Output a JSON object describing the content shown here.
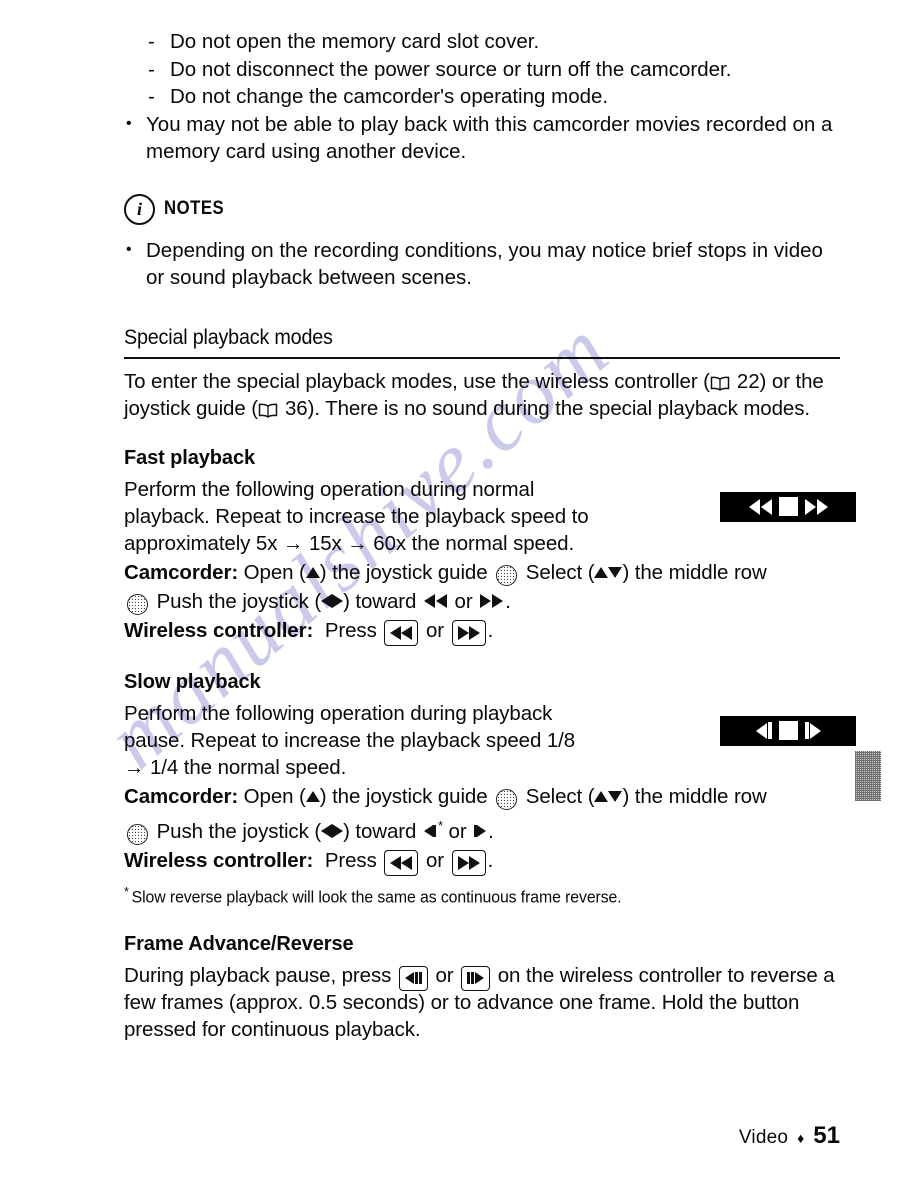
{
  "page": {
    "footer_label": "Video",
    "footer_separator": "♦",
    "footer_page_number": "51",
    "watermark": "manualshive.com"
  },
  "warnings": {
    "dash_items": [
      "Do not open the memory card slot cover.",
      "Do not disconnect the power source or turn off the camcorder.",
      "Do not change the camcorder's operating mode."
    ],
    "dash_marker": "-",
    "bullet_marker": "•",
    "bullet_items": [
      "You may not be able to play back with this camcorder movies recorded on a memory card using another device."
    ]
  },
  "notes": {
    "icon": "info-circle-icon",
    "icon_glyph": "i",
    "label": "NOTES",
    "bullet_marker": "•",
    "items": [
      "Depending on the recording conditions, you may notice brief stops in video or sound playback between scenes."
    ]
  },
  "section": {
    "title": "Special playback modes",
    "intro_part1": "To enter the special playback modes, use the wireless controller (",
    "intro_ref1_page": "22",
    "intro_part2": ") or the joystick guide (",
    "intro_ref2_page": "36",
    "intro_part3": "). There is no sound during the special playback modes."
  },
  "fast_playback": {
    "heading": "Fast playback",
    "description": "Perform the following operation during normal playback. Repeat to increase the playback speed to approximately 5x → 15x → 60x the normal speed.",
    "device_shot": {
      "name": "fast-playback-screen",
      "icons": [
        "rewind-double-icon",
        "stop-square-icon",
        "fast-forward-double-icon"
      ]
    },
    "camcorder_label": "Camcorder:",
    "camcorder_t1": "Open (",
    "camcorder_t2": ") the joystick guide",
    "camcorder_t3": "Select (",
    "camcorder_t4": ") the middle row",
    "camcorder_t5": "Push the joystick (",
    "camcorder_t6": ") toward",
    "camcorder_or": "or",
    "camcorder_end": ".",
    "remote_label": "Wireless controller:",
    "remote_t1": "Press",
    "remote_or": "or",
    "remote_end": "."
  },
  "slow_playback": {
    "heading": "Slow playback",
    "description": "Perform the following operation during playback pause. Repeat to increase the playback speed 1/8 → 1/4 the normal speed.",
    "device_shot": {
      "name": "slow-playback-screen",
      "icons": [
        "slow-reverse-icon",
        "stop-square-icon",
        "slow-forward-icon"
      ]
    },
    "camcorder_label": "Camcorder:",
    "camcorder_t1": "Open (",
    "camcorder_t2": ") the joystick guide",
    "camcorder_t3": "Select (",
    "camcorder_t4": ") the middle row",
    "camcorder_t5": "Push the joystick (",
    "camcorder_t6": ") toward",
    "camcorder_star": "*",
    "camcorder_or": "or",
    "camcorder_end": ".",
    "remote_label": "Wireless controller:",
    "remote_t1": "Press",
    "remote_or": "or",
    "remote_end": ".",
    "footnote_star": "*",
    "footnote": "Slow reverse playback will look the same as continuous frame reverse."
  },
  "frame_advance": {
    "heading": "Frame Advance/Reverse",
    "text_part1": "During playback pause, press",
    "text_or": "or",
    "text_part2": "on the wireless controller to reverse a few frames (approx. 0.5 seconds) or to advance one frame. Hold the button pressed for continuous playback."
  },
  "side_tab": {
    "name": "chapter-thumb-tab"
  },
  "colors": {
    "text": "#0a0a0a",
    "watermark": "#c9c8ea",
    "device_screen_bg": "#000000",
    "thumb_tab": "#6e6e6e"
  }
}
